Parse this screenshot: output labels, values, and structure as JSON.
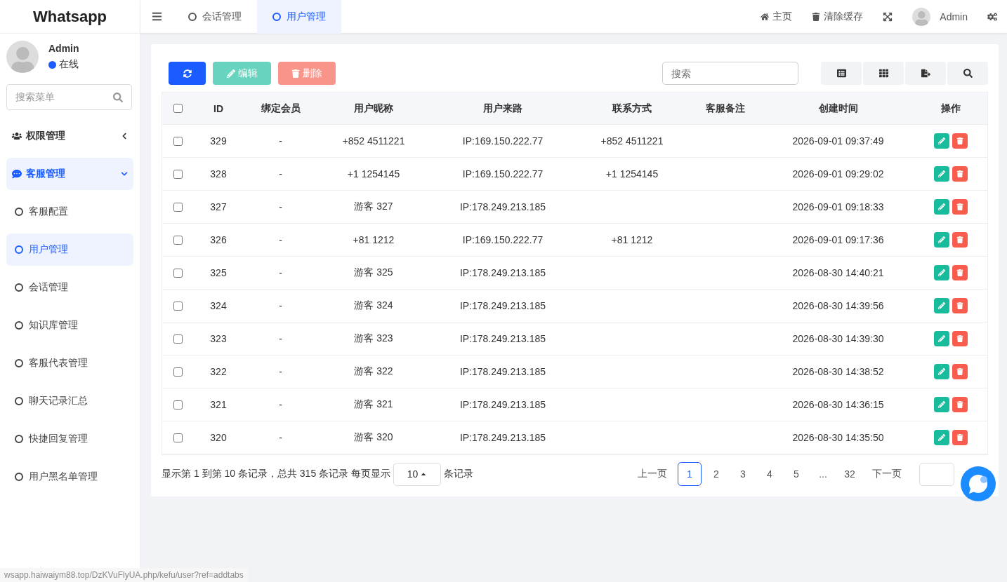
{
  "brand": "Whatsapp",
  "tabs": [
    {
      "label": "会话管理",
      "selected": false
    },
    {
      "label": "用户管理",
      "selected": true
    }
  ],
  "header_links": [
    {
      "kind": "home",
      "label": "主页"
    },
    {
      "kind": "trash",
      "label": "清除缓存"
    },
    {
      "kind": "fullscreen"
    },
    {
      "kind": "user",
      "label": "Admin"
    },
    {
      "kind": "settings"
    }
  ],
  "user": {
    "name": "Admin",
    "status": "在线",
    "online": true
  },
  "menu_search": {
    "placeholder": "搜索菜单"
  },
  "sidebar": {
    "items": [
      {
        "kind": "group",
        "label": "权限管理",
        "expanded": false,
        "selected": false
      },
      {
        "kind": "group",
        "label": "客服管理",
        "expanded": true,
        "selected": true,
        "children": [
          {
            "label": "客服配置",
            "selected": false
          },
          {
            "label": "用户管理",
            "selected": true
          },
          {
            "label": "会话管理",
            "selected": false
          },
          {
            "label": "知识库管理",
            "selected": false
          },
          {
            "label": "客服代表管理",
            "selected": false
          },
          {
            "label": "聊天记录汇总",
            "selected": false
          },
          {
            "label": "快捷回复管理",
            "selected": false
          },
          {
            "label": "用户黑名单管理",
            "selected": false
          }
        ]
      }
    ]
  },
  "toolbar": {
    "buttons": [
      {
        "kind": "refresh",
        "disabled": false
      },
      {
        "kind": "edit",
        "label": "编辑",
        "disabled": true
      },
      {
        "kind": "delete",
        "label": "删除",
        "disabled": true
      }
    ],
    "search": {
      "placeholder": "搜索"
    },
    "tools": [
      {
        "kind": "columns"
      },
      {
        "kind": "grid"
      },
      {
        "kind": "export"
      },
      {
        "kind": "search"
      }
    ]
  },
  "table": {
    "select_all": false,
    "columns": [
      "ID",
      "绑定会员",
      "用户昵称",
      "用户来路",
      "联系方式",
      "客服备注",
      "创建时间",
      "操作"
    ],
    "rows": [
      {
        "checked": false,
        "cells": [
          "329",
          "-",
          "+852 4511221",
          "IP:169.150.222.77",
          "+852 4511221",
          "",
          "2026-09-01 09:37:49"
        ]
      },
      {
        "checked": false,
        "cells": [
          "328",
          "-",
          "+1 1254145",
          "IP:169.150.222.77",
          "+1 1254145",
          "",
          "2026-09-01 09:29:02"
        ]
      },
      {
        "checked": false,
        "cells": [
          "327",
          "-",
          "游客 327",
          "IP:178.249.213.185",
          "",
          "",
          "2026-09-01 09:18:33"
        ]
      },
      {
        "checked": false,
        "cells": [
          "326",
          "-",
          "+81 1212",
          "IP:169.150.222.77",
          "+81 1212",
          "",
          "2026-09-01 09:17:36"
        ]
      },
      {
        "checked": false,
        "cells": [
          "325",
          "-",
          "游客 325",
          "IP:178.249.213.185",
          "",
          "",
          "2026-08-30 14:40:21"
        ]
      },
      {
        "checked": false,
        "cells": [
          "324",
          "-",
          "游客 324",
          "IP:178.249.213.185",
          "",
          "",
          "2026-08-30 14:39:56"
        ]
      },
      {
        "checked": false,
        "cells": [
          "323",
          "-",
          "游客 323",
          "IP:178.249.213.185",
          "",
          "",
          "2026-08-30 14:39:30"
        ]
      },
      {
        "checked": false,
        "cells": [
          "322",
          "-",
          "游客 322",
          "IP:178.249.213.185",
          "",
          "",
          "2026-08-30 14:38:52"
        ]
      },
      {
        "checked": false,
        "cells": [
          "321",
          "-",
          "游客 321",
          "IP:178.249.213.185",
          "",
          "",
          "2026-08-30 14:36:15"
        ]
      },
      {
        "checked": false,
        "cells": [
          "320",
          "-",
          "游客 320",
          "IP:178.249.213.185",
          "",
          "",
          "2026-08-30 14:35:50"
        ]
      }
    ]
  },
  "footer": {
    "summary": "显示第 1 到第 10 条记录，总共 315 条记录 每页显示",
    "page_size": "10",
    "suffix": "条记录",
    "pages": [
      {
        "label": "上一页",
        "kind": "nav",
        "selected": false
      },
      {
        "label": "1",
        "kind": "page",
        "selected": true
      },
      {
        "label": "2",
        "kind": "page",
        "selected": false
      },
      {
        "label": "3",
        "kind": "page",
        "selected": false
      },
      {
        "label": "4",
        "kind": "page",
        "selected": false
      },
      {
        "label": "5",
        "kind": "page",
        "selected": false
      },
      {
        "label": "...",
        "kind": "gap",
        "selected": false
      },
      {
        "label": "32",
        "kind": "page",
        "selected": false
      },
      {
        "label": "下一页",
        "kind": "nav",
        "selected": false
      }
    ]
  },
  "status_url": "wsapp.haiwaiym88.top/DzKVuFlyUA.php/kefu/user?ref=addtabs"
}
